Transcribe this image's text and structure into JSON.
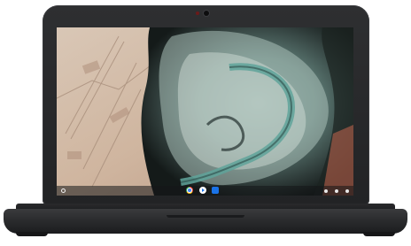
{
  "device": {
    "name": "chromebook-laptop",
    "color": "#2a2b2d"
  },
  "screen": {
    "wallpaper": "aerial-river-delta-satellite",
    "shelf": {
      "launcher_icon": "launcher-circle-icon",
      "pinned_apps": [
        "chrome-icon",
        "play-store-icon",
        "files-icon"
      ],
      "tray_icons": [
        "wifi-icon",
        "battery-icon",
        "account-icon"
      ]
    }
  }
}
